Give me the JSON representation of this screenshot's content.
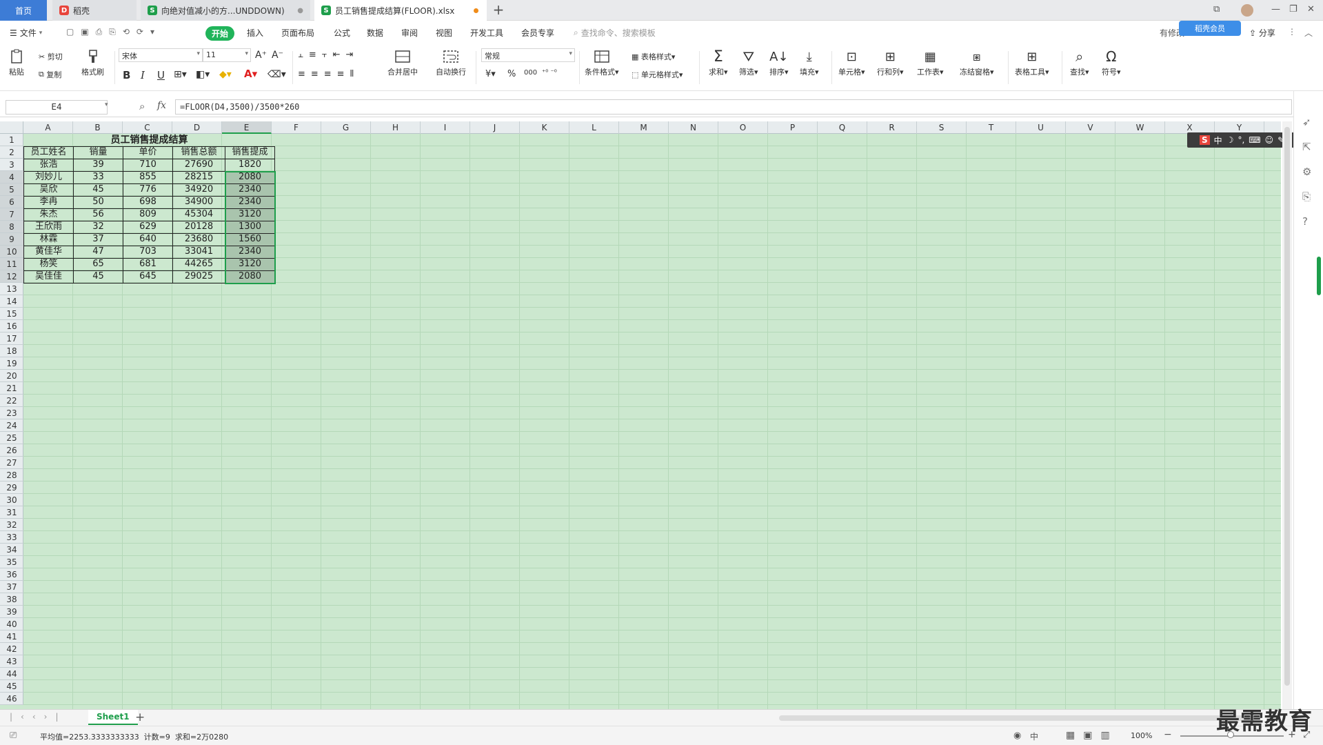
{
  "tabs": {
    "home": "首页",
    "t1": "稻壳",
    "t2": "向绝对值减小的方...UNDDOWN)",
    "t3": "员工销售提成结算(FLOOR).xlsx",
    "new": "+"
  },
  "menu": {
    "file": "文件",
    "items": [
      "开始",
      "插入",
      "页面布局",
      "公式",
      "数据",
      "审阅",
      "视图",
      "开发工具",
      "会员专享"
    ],
    "search": "查找命令、搜索模板",
    "share": "分享",
    "sync": "有修改",
    "login_badge": "稻壳会员"
  },
  "ribbon": {
    "paste": "粘贴",
    "cut": "剪切",
    "copy": "复制",
    "format_painter": "格式刷",
    "font_name": "宋体",
    "font_size": "11",
    "merge": "合并居中",
    "wrap": "自动换行",
    "number_format": "常规",
    "currency": "¥",
    "percent": "%",
    "thousands": "000",
    "cond_format": "条件格式",
    "table_style": "表格样式",
    "cell_style": "单元格样式",
    "sum": "求和",
    "filter": "筛选",
    "sort": "排序",
    "fill": "填充",
    "cell": "单元格",
    "rowcol": "行和列",
    "worksheet": "工作表",
    "freeze": "冻结窗格",
    "table_tools": "表格工具",
    "find": "查找",
    "symbol": "符号"
  },
  "formula_bar": {
    "name_box": "E4",
    "fx": "fx",
    "formula": "=FLOOR(D4,3500)/3500*260"
  },
  "sheet": {
    "columns": [
      "A",
      "B",
      "C",
      "D",
      "E",
      "F",
      "G",
      "H",
      "I",
      "J",
      "K",
      "L",
      "M",
      "N",
      "O",
      "P",
      "Q",
      "R",
      "S",
      "T",
      "U",
      "V",
      "W",
      "X",
      "Y"
    ],
    "title": "员工销售提成结算",
    "headers": [
      "员工姓名",
      "销量",
      "单价",
      "销售总额",
      "销售提成"
    ],
    "rows": [
      [
        "张浩",
        "39",
        "710",
        "27690",
        "1820"
      ],
      [
        "刘妙儿",
        "33",
        "855",
        "28215",
        "2080"
      ],
      [
        "吴欣",
        "45",
        "776",
        "34920",
        "2340"
      ],
      [
        "李冉",
        "50",
        "698",
        "34900",
        "2340"
      ],
      [
        "朱杰",
        "56",
        "809",
        "45304",
        "3120"
      ],
      [
        "王欣雨",
        "32",
        "629",
        "20128",
        "1300"
      ],
      [
        "林霖",
        "37",
        "640",
        "23680",
        "1560"
      ],
      [
        "黄佳华",
        "47",
        "703",
        "33041",
        "2340"
      ],
      [
        "杨笑",
        "65",
        "681",
        "44265",
        "3120"
      ],
      [
        "吴佳佳",
        "45",
        "645",
        "29025",
        "2080"
      ]
    ]
  },
  "sheet_tab": "Sheet1",
  "status": {
    "text": "平均值=2253.3333333333  计数=9  求和=2万0280",
    "zoom": "100%",
    "ime": "中"
  },
  "ime_bar": "中",
  "watermark": "最需教育",
  "colors": {
    "accent": "#1e9e4b",
    "grid_bg": "#cce8cf",
    "tab_active": "#3d7cd6"
  }
}
